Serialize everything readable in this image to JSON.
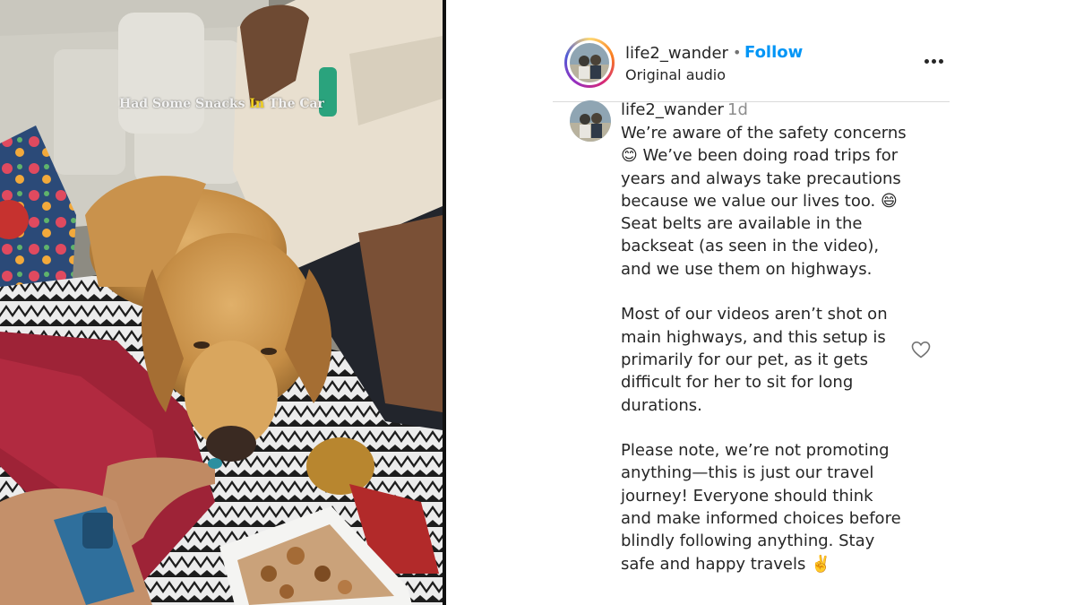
{
  "video": {
    "overlay_caption": {
      "before": "Had Some Snacks ",
      "highlight": "In",
      "after": " The Car"
    }
  },
  "post": {
    "username": "life2_wander",
    "separator": "•",
    "follow_label": "Follow",
    "audio_label": "Original audio",
    "more_icon": "more-options-icon"
  },
  "comment": {
    "username": "life2_wander",
    "time": "1d",
    "paragraphs": [
      "We’re aware of the safety concerns 😊 We’ve been doing road trips for years and always take precautions because we value our lives too. 😄 Seat belts are available in the backseat (as seen in the video), and we use them on highways.",
      "Most of our videos aren’t shot on main highways, and this setup is primarily for our pet, as it gets difficult for her to sit for long durations.",
      "Please note, we’re not promoting anything—this is just our travel journey! Everyone should think and make informed choices before blindly following anything. Stay safe and happy travels ✌️"
    ],
    "like_icon": "heart-icon"
  },
  "colors": {
    "link_blue": "#0095f6",
    "text": "#262626",
    "muted": "#8e8e8e"
  }
}
